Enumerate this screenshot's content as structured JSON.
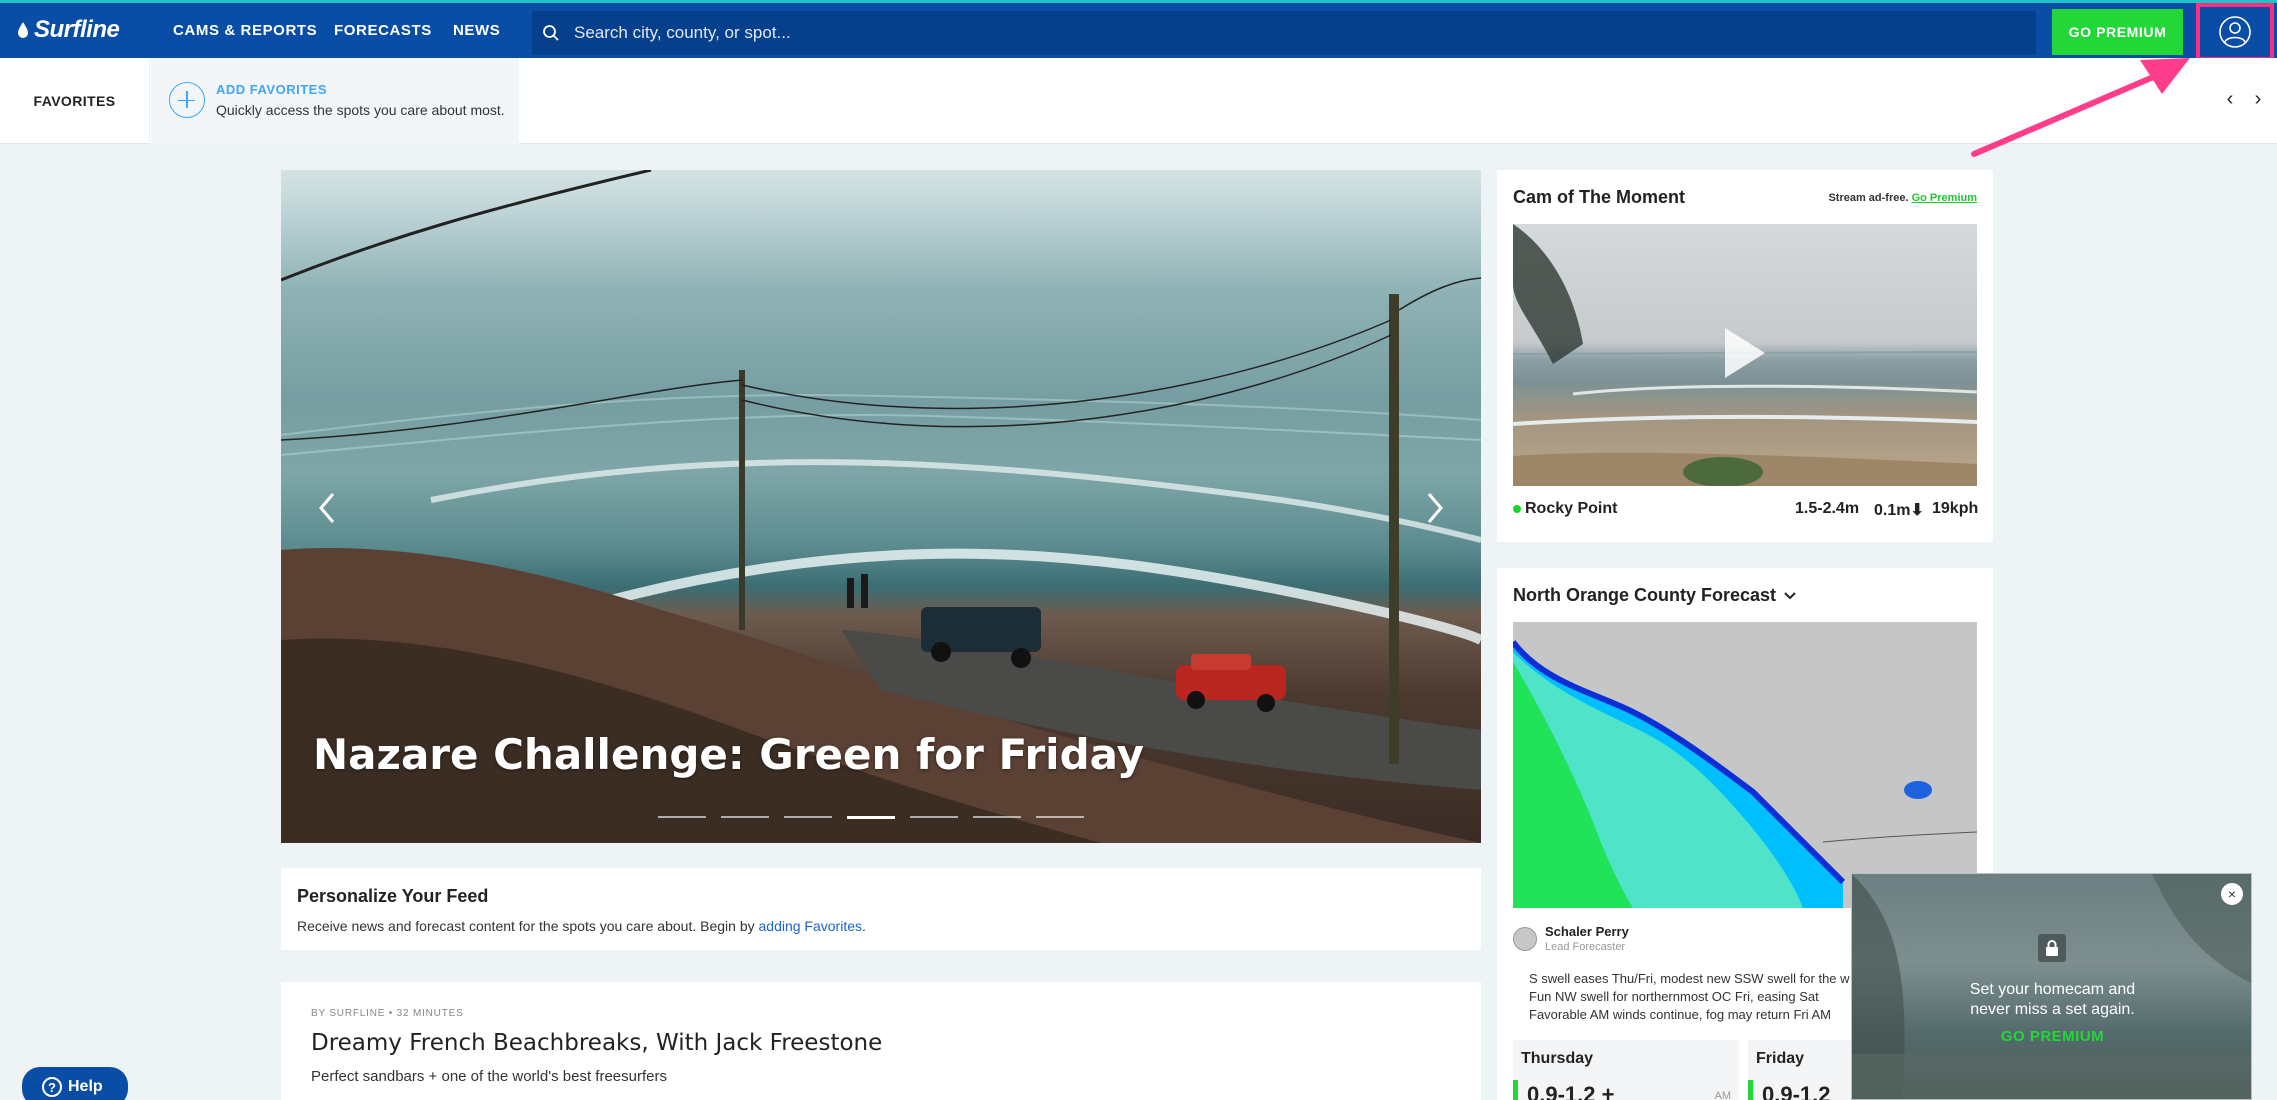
{
  "nav": {
    "logo": "Surfline",
    "links": [
      "CAMS & REPORTS",
      "FORECASTS",
      "NEWS"
    ],
    "search_placeholder": "Search city, county, or spot...",
    "premium_label": "GO PREMIUM"
  },
  "favorites": {
    "label": "FAVORITES",
    "add_title": "ADD FAVORITES",
    "add_subtitle": "Quickly access the spots you care about most."
  },
  "hero": {
    "title": "Nazare Challenge: Green for Friday",
    "slide_count": 7,
    "active_slide": 4
  },
  "personalize": {
    "title": "Personalize Your Feed",
    "text_before": "Receive news and forecast content for the spots you care about. Begin by ",
    "link_text": "adding Favorites",
    "text_after": "."
  },
  "article": {
    "meta": "BY SURFLINE • 32 MINUTES",
    "title": "Dreamy French Beachbreaks, With Jack Freestone",
    "subtitle": "Perfect sandbars + one of the world's best freesurfers"
  },
  "help": {
    "label": "Help"
  },
  "cam": {
    "title": "Cam of The Moment",
    "promo_text": "Stream ad-free. ",
    "promo_link": "Go Premium",
    "spot": "Rocky Point",
    "wave_height": "1.5-2.4m",
    "tide": "0.1m⬇",
    "wind": "19kph"
  },
  "forecast": {
    "title": "North Orange County Forecast",
    "author_name": "Schaler Perry",
    "author_role": "Lead Forecaster",
    "bullets": [
      "S swell eases Thu/Fri, modest new SSW swell for the w",
      "Fun NW swell for northernmost OC Fri, easing Sat",
      "Favorable AM winds continue, fog may return Fri AM"
    ],
    "days": [
      {
        "name": "Thursday",
        "value": "0.9-1.2 +",
        "period": "AM"
      },
      {
        "name": "Friday",
        "value": "0.9-1.2",
        "period": ""
      }
    ]
  },
  "popup": {
    "line1": "Set your homecam and",
    "line2": "never miss a set again.",
    "cta": "GO PREMIUM",
    "close": "×"
  },
  "colors": {
    "nav_blue": "#0a4da6",
    "premium_green": "#22d737",
    "link_blue": "#42a5f5",
    "highlight_pink": "#ff2e82"
  }
}
